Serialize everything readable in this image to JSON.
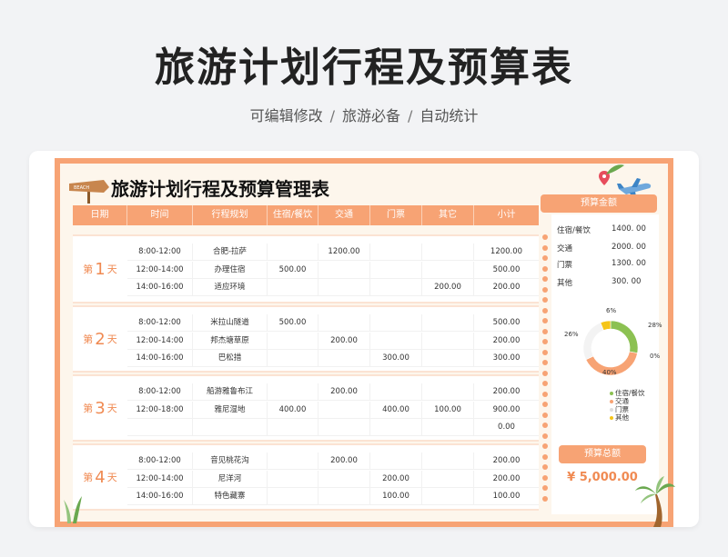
{
  "header": {
    "title": "旅游计划行程及预算表",
    "tagline": [
      "可编辑修改",
      "旅游必备",
      "自动统计"
    ],
    "separator": "/"
  },
  "sheet": {
    "title": "旅游计划行程及预算管理表",
    "sign_text": "BEACH"
  },
  "table": {
    "columns": [
      "日期",
      "时间",
      "行程规划",
      "住宿/餐饮",
      "交通",
      "门票",
      "其它",
      "小计"
    ],
    "days": [
      {
        "prefix": "第",
        "num": "1",
        "suffix": "天",
        "rows": [
          {
            "time": "8:00-12:00",
            "plan": "合肥-拉萨",
            "stay": "",
            "traffic": "1200.00",
            "ticket": "",
            "other": "",
            "sub": "1200.00"
          },
          {
            "time": "12:00-14:00",
            "plan": "办理住宿",
            "stay": "500.00",
            "traffic": "",
            "ticket": "",
            "other": "",
            "sub": "500.00"
          },
          {
            "time": "14:00-16:00",
            "plan": "适应环境",
            "stay": "",
            "traffic": "",
            "ticket": "",
            "other": "200.00",
            "sub": "200.00"
          }
        ]
      },
      {
        "prefix": "第",
        "num": "2",
        "suffix": "天",
        "rows": [
          {
            "time": "8:00-12:00",
            "plan": "米拉山隧道",
            "stay": "500.00",
            "traffic": "",
            "ticket": "",
            "other": "",
            "sub": "500.00"
          },
          {
            "time": "12:00-14:00",
            "plan": "邦杰塘草原",
            "stay": "",
            "traffic": "200.00",
            "ticket": "",
            "other": "",
            "sub": "200.00"
          },
          {
            "time": "14:00-16:00",
            "plan": "巴松措",
            "stay": "",
            "traffic": "",
            "ticket": "300.00",
            "other": "",
            "sub": "300.00"
          }
        ]
      },
      {
        "prefix": "第",
        "num": "3",
        "suffix": "天",
        "rows": [
          {
            "time": "8:00-12:00",
            "plan": "船游雅鲁布江",
            "stay": "",
            "traffic": "200.00",
            "ticket": "",
            "other": "",
            "sub": "200.00"
          },
          {
            "time": "12:00-18:00",
            "plan": "雅尼湿地",
            "stay": "400.00",
            "traffic": "",
            "ticket": "400.00",
            "other": "100.00",
            "sub": "900.00"
          },
          {
            "time": "",
            "plan": "",
            "stay": "",
            "traffic": "",
            "ticket": "",
            "other": "",
            "sub": "0.00"
          }
        ]
      },
      {
        "prefix": "第",
        "num": "4",
        "suffix": "天",
        "rows": [
          {
            "time": "8:00-12:00",
            "plan": "音见桃花沟",
            "stay": "",
            "traffic": "200.00",
            "ticket": "",
            "other": "",
            "sub": "200.00"
          },
          {
            "time": "12:00-14:00",
            "plan": "尼洋河",
            "stay": "",
            "traffic": "",
            "ticket": "200.00",
            "other": "",
            "sub": "200.00"
          },
          {
            "time": "14:00-16:00",
            "plan": "特色藏寨",
            "stay": "",
            "traffic": "",
            "ticket": "100.00",
            "other": "",
            "sub": "100.00"
          }
        ]
      }
    ]
  },
  "budget": {
    "title": "预算金额",
    "items": [
      {
        "label": "住宿/餐饮",
        "value": "1400. 00"
      },
      {
        "label": "交通",
        "value": "2000. 00"
      },
      {
        "label": "门票",
        "value": "1300. 00"
      },
      {
        "label": "其他",
        "value": "300. 00"
      }
    ],
    "total_label": "预算总额",
    "total_value": "¥ 5,000.00"
  },
  "chart_data": {
    "type": "pie",
    "categories": [
      "住宿/餐饮",
      "交通",
      "门票",
      "其他"
    ],
    "values": [
      28,
      40,
      26,
      6
    ],
    "labels": [
      "28%",
      "0%",
      "40%",
      "26%",
      "6%"
    ],
    "colors": [
      "#8cc152",
      "#f7a374",
      "#f3f3f3",
      "#f5c518"
    ]
  }
}
